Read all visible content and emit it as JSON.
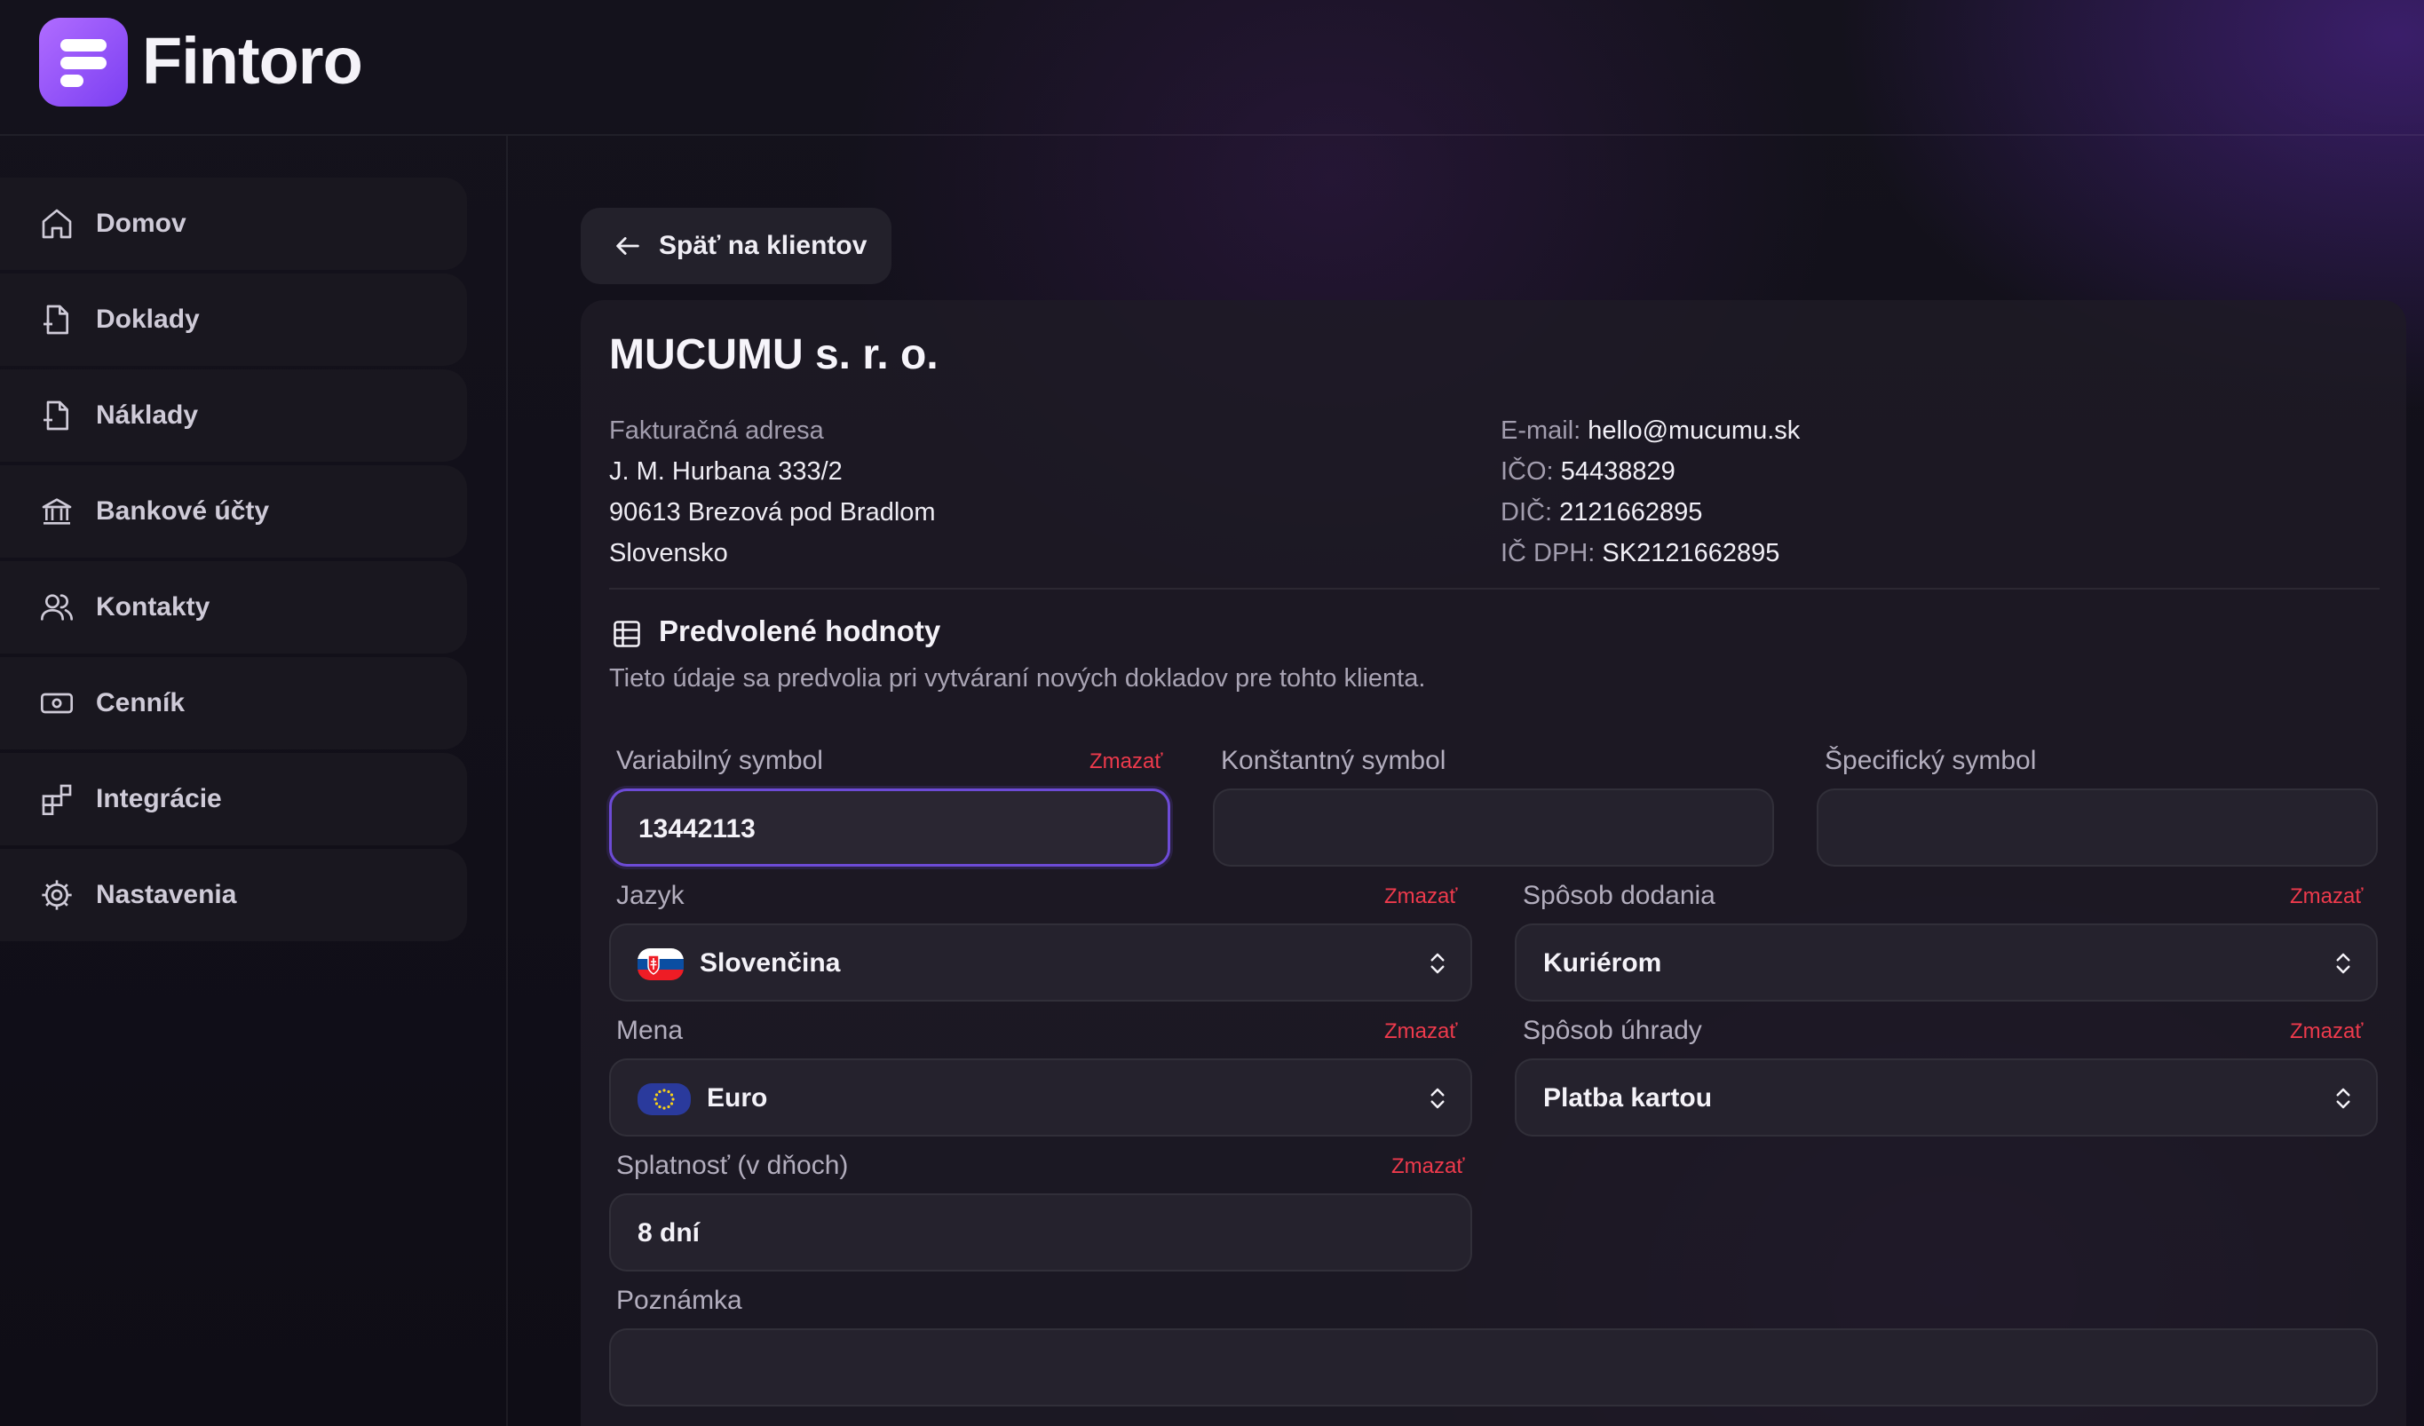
{
  "app": {
    "name": "Fintoro"
  },
  "sidebar": {
    "items": [
      {
        "label": "Domov",
        "icon": "home-icon"
      },
      {
        "label": "Doklady",
        "icon": "document-add-icon"
      },
      {
        "label": "Náklady",
        "icon": "document-minus-icon"
      },
      {
        "label": "Bankové účty",
        "icon": "bank-icon"
      },
      {
        "label": "Kontakty",
        "icon": "users-icon"
      },
      {
        "label": "Cenník",
        "icon": "banknote-icon"
      },
      {
        "label": "Integrácie",
        "icon": "integrations-icon"
      },
      {
        "label": "Nastavenia",
        "icon": "gear-icon"
      }
    ]
  },
  "back_button": {
    "label": "Späť na klientov",
    "icon": "arrow-left-icon"
  },
  "client": {
    "name": "MUCUMU s. r. o.",
    "address_label": "Fakturačná adresa",
    "street": "J. M. Hurbana 333/2",
    "city": "90613 Brezová pod Bradlom",
    "country": "Slovensko",
    "email_label": "E-mail:",
    "email": "hello@mucumu.sk",
    "ico_label": "IČO:",
    "ico": "54438829",
    "dic_label": "DIČ:",
    "dic": "2121662895",
    "icdph_label": "IČ DPH:",
    "icdph": "SK2121662895"
  },
  "defaults": {
    "title": "Predvolené hodnoty",
    "icon": "table-icon",
    "description": "Tieto údaje sa predvolia pri vytváraní nových dokladov pre tohto klienta.",
    "clear_label": "Zmazať",
    "variable_symbol": {
      "label": "Variabilný symbol",
      "value": "13442113"
    },
    "constant_symbol": {
      "label": "Konštantný symbol",
      "value": ""
    },
    "specific_symbol": {
      "label": "Špecifický symbol",
      "value": ""
    },
    "language": {
      "label": "Jazyk",
      "value": "Slovenčina",
      "flag": "slovakia-flag-icon"
    },
    "delivery": {
      "label": "Spôsob dodania",
      "value": "Kuriérom"
    },
    "currency": {
      "label": "Mena",
      "value": "Euro",
      "flag": "eu-flag-icon"
    },
    "payment": {
      "label": "Spôsob úhrady",
      "value": "Platba kartou"
    },
    "due": {
      "label": "Splatnosť (v dňoch)",
      "value": "8 dní"
    },
    "note": {
      "label": "Poznámka",
      "value": ""
    }
  },
  "colors": {
    "accent": "#7b3ff2",
    "danger": "#ee3a4c"
  }
}
